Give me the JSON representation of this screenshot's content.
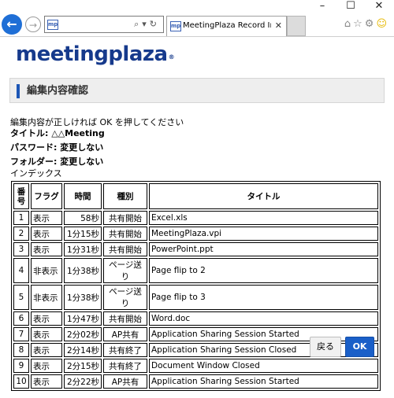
{
  "browser": {
    "window_controls": {
      "minimize": "–",
      "maximize": "☐",
      "close": "✕"
    },
    "address_favicon": "mp",
    "tab": {
      "title": "MeetingPlaza Record Infor...",
      "close": "✕"
    },
    "colors": {
      "back_button": "#1f6fd6"
    }
  },
  "page": {
    "logo": {
      "text": "meetingplaza",
      "mark": "®"
    },
    "heading": "編集内容確認",
    "instruction": "編集内容が正しければ OK を押してください",
    "fields": {
      "title": "タイトル: △△Meeting",
      "password": "パスワード: 変更しない",
      "folder": "フォルダー: 変更しない"
    },
    "index_label": "インデックス",
    "table": {
      "headers": [
        "番号",
        "フラグ",
        "時間",
        "種別",
        "タイトル"
      ],
      "rows": [
        [
          "1",
          "表示",
          "58秒",
          "共有開始",
          "Excel.xls"
        ],
        [
          "2",
          "表示",
          "1分15秒",
          "共有開始",
          "MeetingPlaza.vpi"
        ],
        [
          "3",
          "表示",
          "1分31秒",
          "共有開始",
          "PowerPoint.ppt"
        ],
        [
          "4",
          "非表示",
          "1分38秒",
          "ページ送り",
          "Page flip to 2"
        ],
        [
          "5",
          "非表示",
          "1分38秒",
          "ページ送り",
          "Page flip to 3"
        ],
        [
          "6",
          "表示",
          "1分47秒",
          "共有開始",
          "Word.doc"
        ],
        [
          "7",
          "表示",
          "2分02秒",
          "AP共有",
          "Application Sharing Session Started"
        ],
        [
          "8",
          "表示",
          "2分14秒",
          "共有終了",
          "Application Sharing Session Closed"
        ],
        [
          "9",
          "表示",
          "2分15秒",
          "共有終了",
          "Document Window Closed"
        ],
        [
          "10",
          "表示",
          "2分22秒",
          "AP共有",
          "Application Sharing Session Started"
        ]
      ]
    },
    "buttons": {
      "back": "戻る",
      "ok": "OK"
    },
    "colors": {
      "accent": "#1a5fc8",
      "logo": "#163a8c"
    }
  }
}
